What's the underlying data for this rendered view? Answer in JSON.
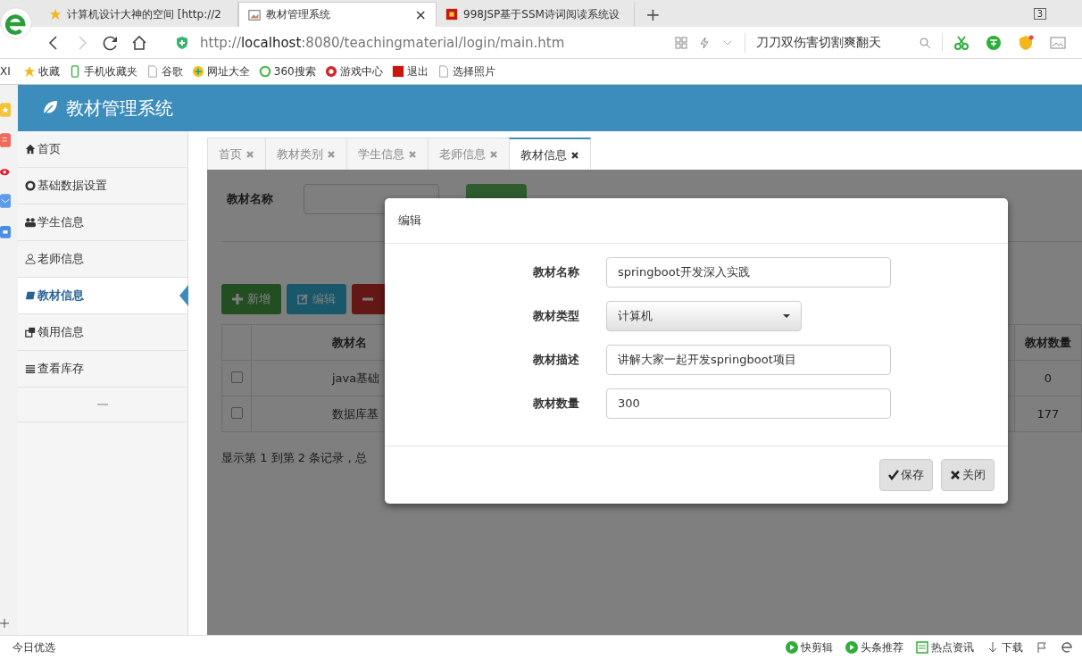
{
  "browser": {
    "tabs": [
      {
        "title": "计算机设计大神的空间 [http://2",
        "selected": false
      },
      {
        "title": "教材管理系统",
        "selected": true
      },
      {
        "title": "998JSP基于SSM诗词阅读系统设",
        "selected": false
      }
    ],
    "new_tab": "+",
    "tab_count": "3",
    "close": "×",
    "address": "http://**localhost**:8080/teachingmaterial/login/main.htm",
    "search": "刀刀双伤害切割爽翻天",
    "bookmarks_edge": "XI",
    "bookmarks": [
      "收藏",
      "手机收藏夹",
      "谷歌",
      "网址大全",
      "360搜索",
      "游戏中心",
      "退出",
      "选择照片"
    ]
  },
  "app": {
    "title": "教材管理系统",
    "menu": [
      {
        "label": "首页",
        "selected": false
      },
      {
        "label": "基础数据设置",
        "selected": false
      },
      {
        "label": "学生信息",
        "selected": false
      },
      {
        "label": "老师信息",
        "selected": false
      },
      {
        "label": "教材信息",
        "selected": true
      },
      {
        "label": "领用信息",
        "selected": false
      },
      {
        "label": "查看库存",
        "selected": false
      }
    ],
    "tabs": [
      {
        "label": "首页",
        "selected": false
      },
      {
        "label": "教材类别",
        "selected": false
      },
      {
        "label": "学生信息",
        "selected": false
      },
      {
        "label": "老师信息",
        "selected": false
      },
      {
        "label": "教材信息",
        "selected": true
      }
    ]
  },
  "page": {
    "search_label": "教材名称",
    "buttons": [
      {
        "label": "新增",
        "kind": "add"
      },
      {
        "label": "编辑",
        "kind": "edit"
      },
      {
        "kind": "delete"
      }
    ],
    "table": {
      "columns": [
        "教材名",
        "教材数量"
      ],
      "rows": [
        {
          "checked": false,
          "name": "java基础",
          "count": "0"
        },
        {
          "checked": false,
          "name": "数据库基",
          "count": "177"
        }
      ]
    },
    "footer": "显示第 1 到第 2 条记录，总"
  },
  "dialog": {
    "title": "编辑",
    "fields": [
      {
        "label": "教材名称",
        "kind": "text",
        "value": "springboot开发深入实践"
      },
      {
        "label": "教材类型",
        "kind": "select",
        "value": "计算机"
      },
      {
        "label": "教材描述",
        "kind": "text",
        "value": "讲解大家一起开发springboot项目"
      },
      {
        "label": "教材数量",
        "kind": "text",
        "value": "300"
      }
    ],
    "buttons": [
      {
        "label": "保存",
        "kind": "save"
      },
      {
        "label": "关闭",
        "kind": "close"
      }
    ]
  },
  "status_bar": {
    "left": "今日优选",
    "items": [
      "快剪辑",
      "头条推荐",
      "热点资讯",
      "下载"
    ]
  }
}
